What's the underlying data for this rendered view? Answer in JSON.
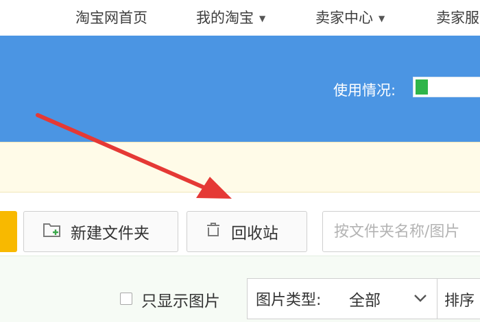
{
  "topnav": {
    "items": [
      {
        "label": "淘宝网首页",
        "has_caret": false
      },
      {
        "label": "我的淘宝",
        "has_caret": true
      },
      {
        "label": "卖家中心",
        "has_caret": true
      },
      {
        "label": "卖家服",
        "has_caret": false
      }
    ]
  },
  "header": {
    "usage_label": "使用情况:",
    "usage_fraction": 0.18
  },
  "toolbar": {
    "new_folder_label": "新建文件夹",
    "recycle_label": "回收站",
    "search_placeholder": "按文件夹名称/图片"
  },
  "filters": {
    "only_images_label": "只显示图片",
    "only_images_checked": false,
    "image_type_label": "图片类型:",
    "image_type_value": "全部",
    "sort_label": "排序"
  },
  "colors": {
    "banner": "#4b95e3",
    "usage_fill": "#2fb54a",
    "upload_button": "#f8b900",
    "annotation_arrow": "#e53935"
  },
  "icons": {
    "new_folder": "folder-plus-icon",
    "recycle": "trash-icon",
    "dropdown": "chevron-down-icon"
  }
}
